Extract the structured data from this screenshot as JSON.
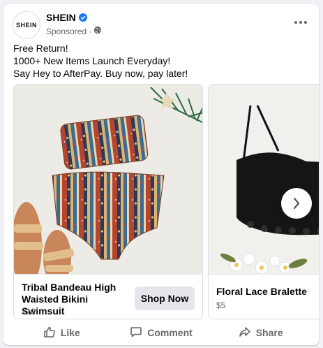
{
  "page": {
    "name": "SHEIN",
    "avatar_text": "SHEIN",
    "sponsored": "Sponsored ·"
  },
  "post": {
    "lines": [
      "Free Return!",
      "1000+ New Items Launch Everyday!",
      "Say Hey to AfterPay. Buy now, pay later!"
    ]
  },
  "carousel": {
    "items": [
      {
        "title": "Tribal Bandeau High Waisted Bikini Swimsuit",
        "price": "$13",
        "cta": "Shop Now",
        "icon": "bikini-image"
      },
      {
        "title": "Floral Lace Bralette",
        "price": "$5",
        "icon": "bralette-image"
      }
    ]
  },
  "actions": {
    "like": "Like",
    "comment": "Comment",
    "share": "Share"
  },
  "icons": {
    "verified": "verified-badge-icon",
    "audience": "globe-icon",
    "more": "more-options-icon",
    "next": "chevron-right-icon"
  },
  "colors": {
    "verified_blue": "#1877f2",
    "secondary_text": "#65676b",
    "button_bg": "#e4e6eb"
  }
}
